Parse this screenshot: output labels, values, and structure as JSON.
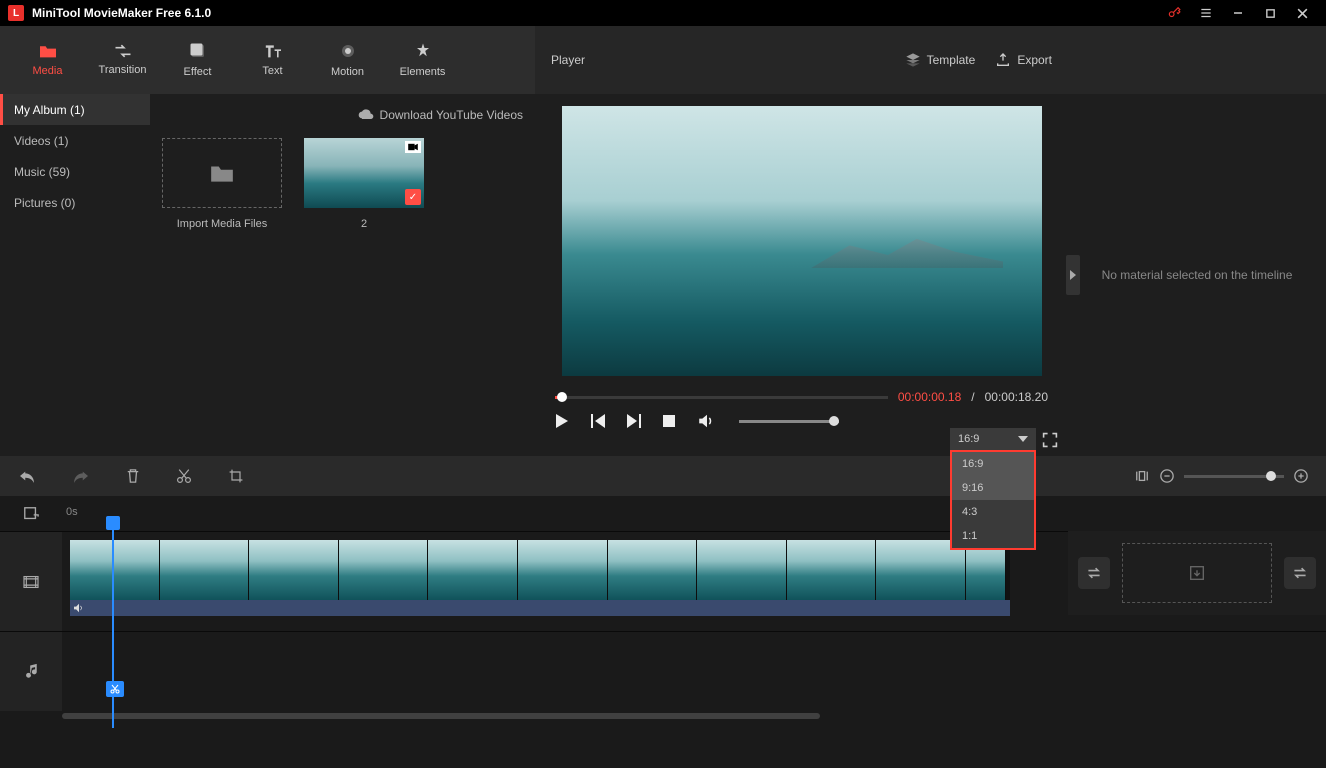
{
  "app": {
    "title": "MiniTool MovieMaker Free 6.1.0"
  },
  "tabs": {
    "media": "Media",
    "transition": "Transition",
    "effect": "Effect",
    "text": "Text",
    "motion": "Motion",
    "elements": "Elements"
  },
  "player": {
    "title": "Player",
    "template": "Template",
    "export": "Export",
    "current": "00:00:00.18",
    "sep": " / ",
    "total": "00:00:18.20",
    "ratio_selected": "16:9",
    "ratio_options": [
      "16:9",
      "9:16",
      "4:3",
      "1:1"
    ]
  },
  "sidebar": {
    "album": "My Album (1)",
    "videos": "Videos (1)",
    "music": "Music (59)",
    "pictures": "Pictures (0)"
  },
  "media": {
    "download": "Download YouTube Videos",
    "import_label": "Import Media Files",
    "thumb_label": "2"
  },
  "inspector": {
    "empty": "No material selected on the timeline"
  },
  "timeline": {
    "zero": "0s"
  }
}
